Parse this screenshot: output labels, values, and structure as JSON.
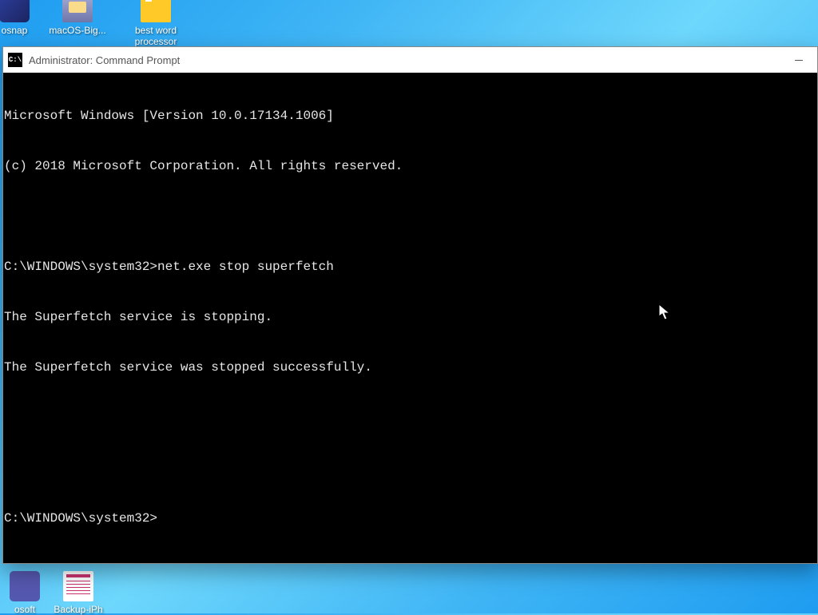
{
  "desktop": {
    "icons": {
      "osnap": "osnap",
      "macosbig": "macOS-Big...",
      "bestword": "best word processor",
      "osoft": "osoft",
      "backup": "Backup-iPh"
    }
  },
  "window": {
    "title": "Administrator: Command Prompt",
    "appIconText": "C:\\"
  },
  "terminal": {
    "l1": "Microsoft Windows [Version 10.0.17134.1006]",
    "l2": "(c) 2018 Microsoft Corporation. All rights reserved.",
    "blank1": " ",
    "prompt1": "C:\\WINDOWS\\system32>",
    "command1": "net.exe stop superfetch",
    "l3": "The Superfetch service is stopping.",
    "l4": "The Superfetch service was stopped successfully.",
    "blank2": " ",
    "blank3": " ",
    "prompt2": "C:\\WINDOWS\\system32>"
  }
}
